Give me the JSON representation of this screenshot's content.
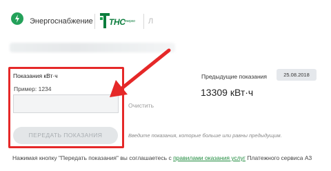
{
  "header": {
    "brand1": "Энергоснабжение",
    "brand2_main": "ТНС",
    "brand2_sub": "энерго",
    "brand3": "Л"
  },
  "form": {
    "label": "Показания кВт·ч",
    "example": "Пример: 1234",
    "input_value": "",
    "clear_label": "Очистить",
    "submit_label": "ПЕРЕДАТЬ ПОКАЗАНИЯ",
    "hint": "Введите показания, которые больше или равны предыдущим."
  },
  "previous": {
    "label": "Предыдущие показания",
    "date": "25.08.2018",
    "value": "13309 кВт·ч"
  },
  "consent": {
    "prefix": "Нажимая кнопку \"Передать показания\" вы соглашаетесь с ",
    "link": "правилами оказания услуг",
    "suffix": " Платежного сервиса А3"
  },
  "colors": {
    "brand_green": "#24a15a",
    "highlight_red": "#e52828",
    "link_green": "#1e8b3d"
  },
  "icons": {
    "logo1": "lightning-icon",
    "logo2": "tns-t-icon",
    "arrow": "red-arrow-annotation"
  }
}
